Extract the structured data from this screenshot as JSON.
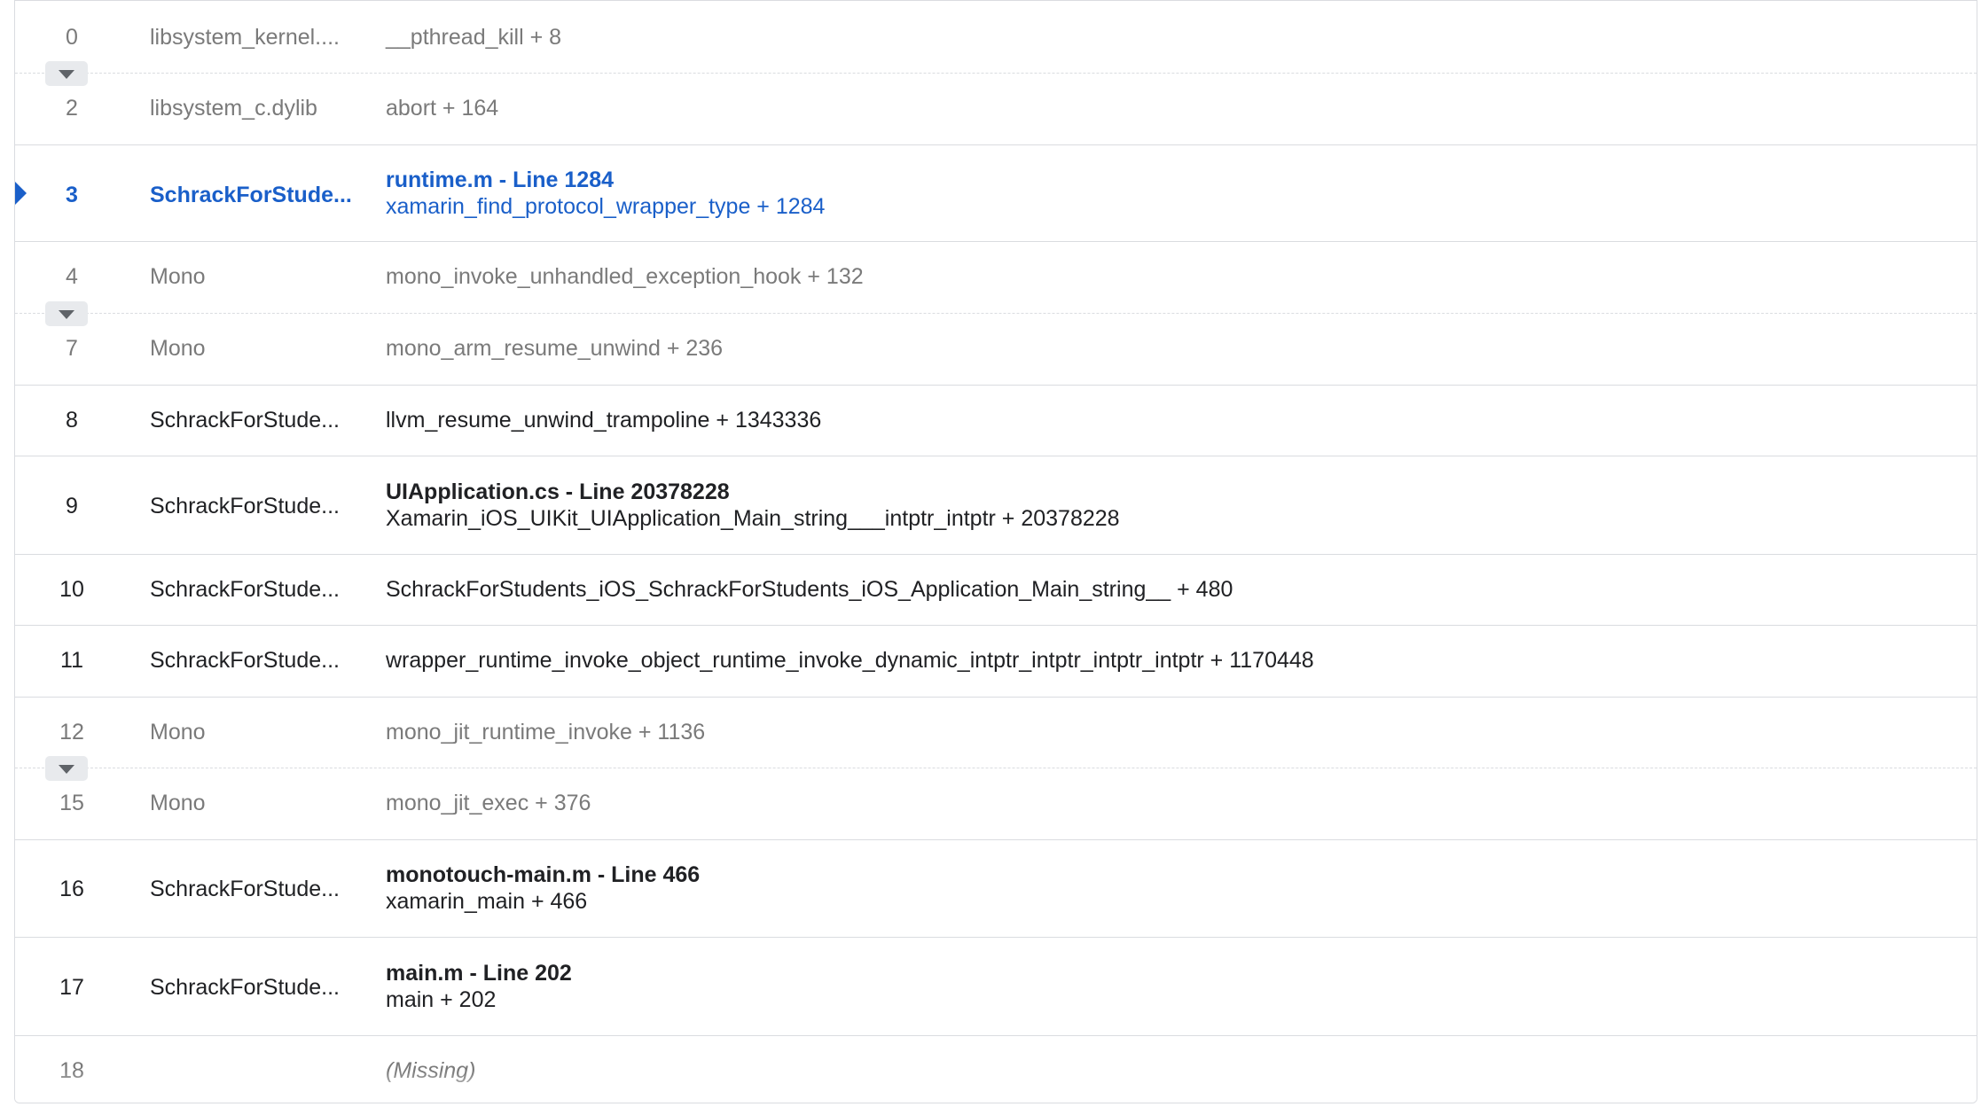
{
  "frames": [
    {
      "index": "0",
      "library": "libsystem_kernel....",
      "fn_title": "",
      "fn_detail": "__pthread_kill + 8",
      "style": "dim"
    },
    {
      "index": "2",
      "library": "libsystem_c.dylib",
      "fn_title": "",
      "fn_detail": "abort + 164",
      "style": "dim"
    },
    {
      "index": "3",
      "library": "SchrackForStude...",
      "fn_title": "runtime.m - Line 1284",
      "fn_detail": "xamarin_find_protocol_wrapper_type + 1284",
      "style": "active"
    },
    {
      "index": "4",
      "library": "Mono",
      "fn_title": "",
      "fn_detail": "mono_invoke_unhandled_exception_hook + 132",
      "style": "dim"
    },
    {
      "index": "7",
      "library": "Mono",
      "fn_title": "",
      "fn_detail": "mono_arm_resume_unwind + 236",
      "style": "dim"
    },
    {
      "index": "8",
      "library": "SchrackForStude...",
      "fn_title": "",
      "fn_detail": "llvm_resume_unwind_trampoline + 1343336",
      "style": "normal"
    },
    {
      "index": "9",
      "library": "SchrackForStude...",
      "fn_title": "UIApplication.cs - Line 20378228",
      "fn_detail": "Xamarin_iOS_UIKit_UIApplication_Main_string___intptr_intptr + 20378228",
      "style": "normal"
    },
    {
      "index": "10",
      "library": "SchrackForStude...",
      "fn_title": "",
      "fn_detail": "SchrackForStudents_iOS_SchrackForStudents_iOS_Application_Main_string__ + 480",
      "style": "normal"
    },
    {
      "index": "11",
      "library": "SchrackForStude...",
      "fn_title": "",
      "fn_detail": "wrapper_runtime_invoke_object_runtime_invoke_dynamic_intptr_intptr_intptr_intptr + 1170448",
      "style": "normal"
    },
    {
      "index": "12",
      "library": "Mono",
      "fn_title": "",
      "fn_detail": "mono_jit_runtime_invoke + 1136",
      "style": "dim"
    },
    {
      "index": "15",
      "library": "Mono",
      "fn_title": "",
      "fn_detail": "mono_jit_exec + 376",
      "style": "dim"
    },
    {
      "index": "16",
      "library": "SchrackForStude...",
      "fn_title": "monotouch-main.m - Line 466",
      "fn_detail": "xamarin_main + 466",
      "style": "normal"
    },
    {
      "index": "17",
      "library": "SchrackForStude...",
      "fn_title": "main.m - Line 202",
      "fn_detail": "main + 202",
      "style": "normal"
    },
    {
      "index": "18",
      "library": "",
      "fn_title": "",
      "fn_detail": "(Missing)",
      "style": "dim"
    }
  ],
  "icons": {
    "expand": "chevron-down-icon",
    "selected": "caret-right-icon"
  },
  "colors": {
    "active": "#1a5fc9",
    "dim": "#7a7a7a",
    "text": "#202124",
    "divider": "#dadce0"
  }
}
